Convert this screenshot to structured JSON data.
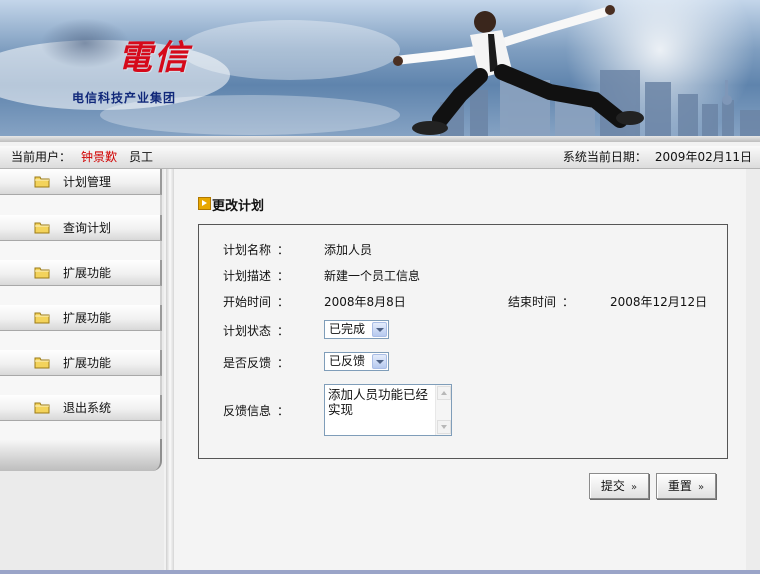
{
  "banner": {
    "logo_text": "電信",
    "company_name": "电信科技产业集团"
  },
  "status": {
    "user_label": "当前用户：",
    "user_name": "钟景歎",
    "user_role": "员工",
    "date_label": "系统当前日期：",
    "date_value": "2009年02月11日"
  },
  "sidebar": {
    "items": [
      {
        "label": "计划管理",
        "icon": "folder-icon"
      },
      {
        "label": "查询计划",
        "icon": "folder-icon"
      },
      {
        "label": "扩展功能",
        "icon": "folder-icon"
      },
      {
        "label": "扩展功能",
        "icon": "folder-icon"
      },
      {
        "label": "扩展功能",
        "icon": "folder-icon"
      },
      {
        "label": "退出系统",
        "icon": "folder-icon"
      }
    ]
  },
  "form": {
    "title": "更改计划",
    "colon": "：",
    "plan_name": {
      "label": "计划名称",
      "value": "添加人员"
    },
    "plan_desc": {
      "label": "计划描述",
      "value": "新建一个员工信息"
    },
    "start_time": {
      "label": "开始时间",
      "value": "2008年8月8日"
    },
    "end_time": {
      "label": "结束时间",
      "value": "2008年12月12日"
    },
    "plan_status": {
      "label": "计划状态",
      "value": "已完成"
    },
    "feedback": {
      "label": "是否反馈",
      "value": "已反馈"
    },
    "feedback_info": {
      "label": "反馈信息",
      "value": "添加人员功能已经实现"
    }
  },
  "buttons": {
    "submit": "提交",
    "reset": "重置",
    "arrow": "»"
  },
  "colors": {
    "user_name": "#d10000",
    "logo": "#d6091a",
    "company": "#10287a",
    "title_icon": "#e8a800"
  }
}
